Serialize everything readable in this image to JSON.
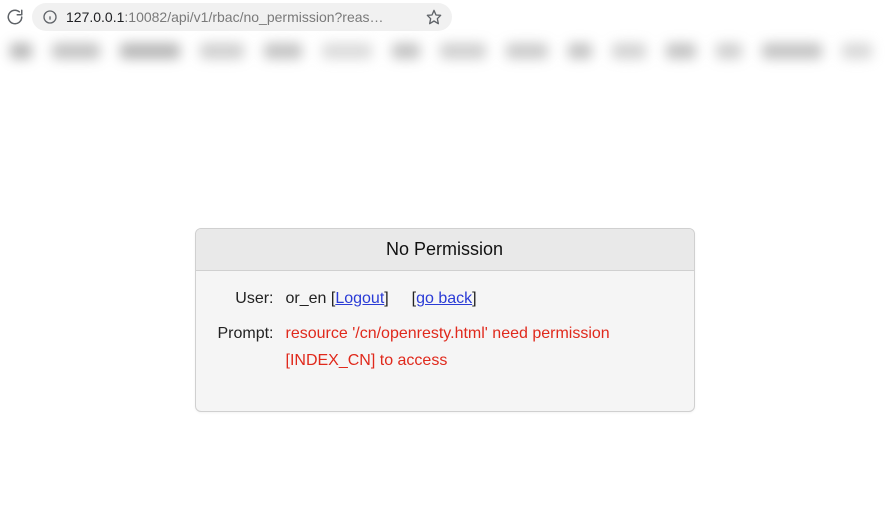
{
  "browser": {
    "url_host": "127.0.0.1",
    "url_rest": ":10082/api/v1/rbac/no_permission?reas…"
  },
  "panel": {
    "title": "No Permission",
    "user_label": "User:",
    "user_value": "or_en",
    "logout_label": "Logout",
    "goback_label": "go back",
    "prompt_label": "Prompt:",
    "prompt_value": "resource '/cn/openresty.html' need permission [INDEX_CN] to access"
  }
}
